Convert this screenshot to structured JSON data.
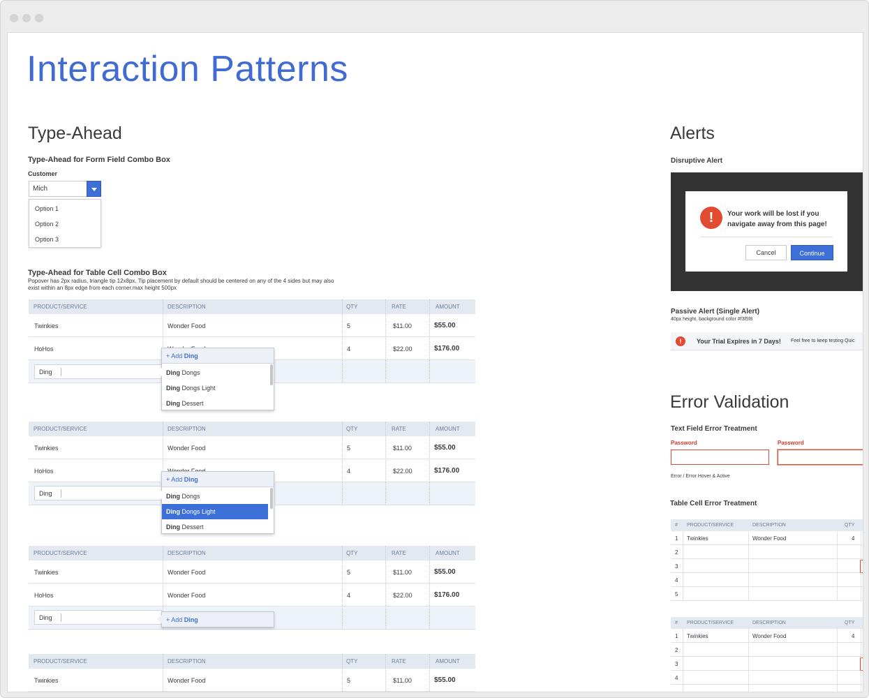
{
  "page": {
    "title": "Interaction Patterns"
  },
  "typeahead": {
    "heading": "Type-Ahead",
    "form_section": {
      "title": "Type-Ahead for Form Field Combo Box",
      "field_label": "Customer",
      "field_value": "Mich",
      "options": [
        "Option 1",
        "Option 2",
        "Option 3"
      ]
    },
    "table_section": {
      "title": "Type-Ahead for Table Cell Combo Box",
      "note": "Popover has 2px radius, triangle tip 12x8px. Tip placement by default should be centered on any of the 4 sides but may also exist within an 8px edge from each corner.max height 500px"
    },
    "columns": [
      "PRODUCT/SERVICE",
      "DESCRIPTION",
      "QTY",
      "RATE",
      "AMOUNT"
    ],
    "rows": [
      {
        "product": "Twinkies",
        "description": "Wonder Food",
        "qty": "5",
        "rate": "$11.00",
        "amount": "$55.00"
      },
      {
        "product": "HoHos",
        "description": "Wonder Food",
        "qty": "4",
        "rate": "$22.00",
        "amount": "$176.00"
      }
    ],
    "input_value": "Ding",
    "add_prefix": "+ Add ",
    "add_term": "Ding",
    "match": "Ding",
    "suggestions": [
      " Dongs",
      " Dongs Light",
      " Dessert"
    ],
    "hohos_partial": "Wonder Food"
  },
  "alerts": {
    "heading": "Alerts",
    "disruptive": {
      "title": "Disruptive Alert",
      "message_line1": "Your work will be lost if you",
      "message_line2": "navigate away from this page!",
      "cancel": "Cancel",
      "continue": "Continue",
      "icon": "!"
    },
    "passive": {
      "title": "Passive Alert (Single Alert)",
      "note": "40px height, background color #f3f5f8",
      "message": "Your Trial Expires in 7 Days!",
      "detail": "Feel free to keep testing Quic",
      "icon": "!"
    }
  },
  "errors": {
    "heading": "Error Validation",
    "text_field": {
      "title": "Text Field Error Treatment",
      "label1": "Password",
      "label2": "Password",
      "caption": "Error / Error Hover & Active"
    },
    "table_cell": {
      "title": "Table Cell Error Treatment",
      "columns": [
        "#",
        "PRODUCT/SERVICE",
        "DESCRIPTION",
        "QTY"
      ],
      "row1": {
        "num": "1",
        "product": "Twinkies",
        "description": "Wonder Food",
        "qty": "4"
      },
      "nums": [
        "2",
        "3",
        "4",
        "5"
      ]
    }
  },
  "colors": {
    "accent": "#3f6bd3",
    "error": "#e04b32",
    "header_bg": "#e3e9f1",
    "dark_overlay": "#333333"
  }
}
